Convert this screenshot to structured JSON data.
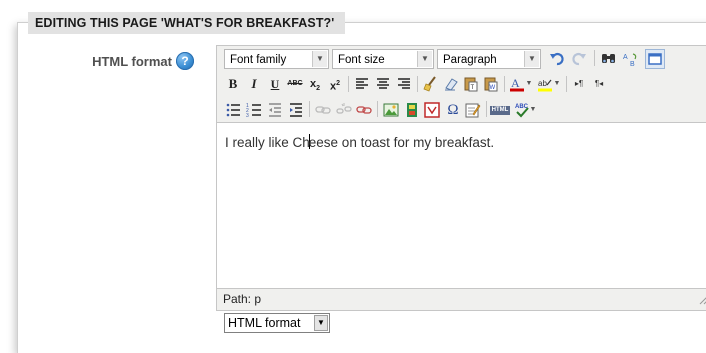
{
  "legend": "EDITING THIS PAGE 'WHAT'S FOR BREAKFAST?'",
  "field": {
    "label": "HTML format",
    "help_icon": "help-icon"
  },
  "editor": {
    "font_family": "Font family",
    "font_size": "Font size",
    "block_format": "Paragraph",
    "content_before_caret": "I really like Ch",
    "content_after_caret": "eese on toast for my breakfast.",
    "path": "Path: p"
  },
  "toolbar_icons": {
    "row1": [
      "undo-icon",
      "redo-icon",
      "find-icon",
      "replace-icon",
      "fullscreen-icon"
    ],
    "row2": [
      "bold-icon",
      "italic-icon",
      "underline-icon",
      "strikethrough-icon",
      "subscript-icon",
      "superscript-icon",
      "align-left-icon",
      "align-center-icon",
      "align-right-icon",
      "cleanup-icon",
      "remove-format-icon",
      "paste-text-icon",
      "paste-word-icon",
      "text-color-icon",
      "highlight-color-icon",
      "ltr-icon",
      "rtl-icon"
    ],
    "row3": [
      "bullet-list-icon",
      "numbered-list-icon",
      "outdent-icon",
      "indent-icon",
      "link-icon",
      "unlink-icon",
      "anchor-icon",
      "image-icon",
      "media-icon",
      "emoticon-icon",
      "special-char-icon",
      "edit-html-icon",
      "spellcheck-icon"
    ]
  },
  "format_select": {
    "value": "HTML format"
  },
  "colors": {
    "legend_bg": "#e2e2e2",
    "toolbar_bg": "#f0f0ee",
    "help_blue": "#3c8fd4",
    "text_color_red": "#cc0000",
    "highlight_yellow": "#ffff00"
  }
}
